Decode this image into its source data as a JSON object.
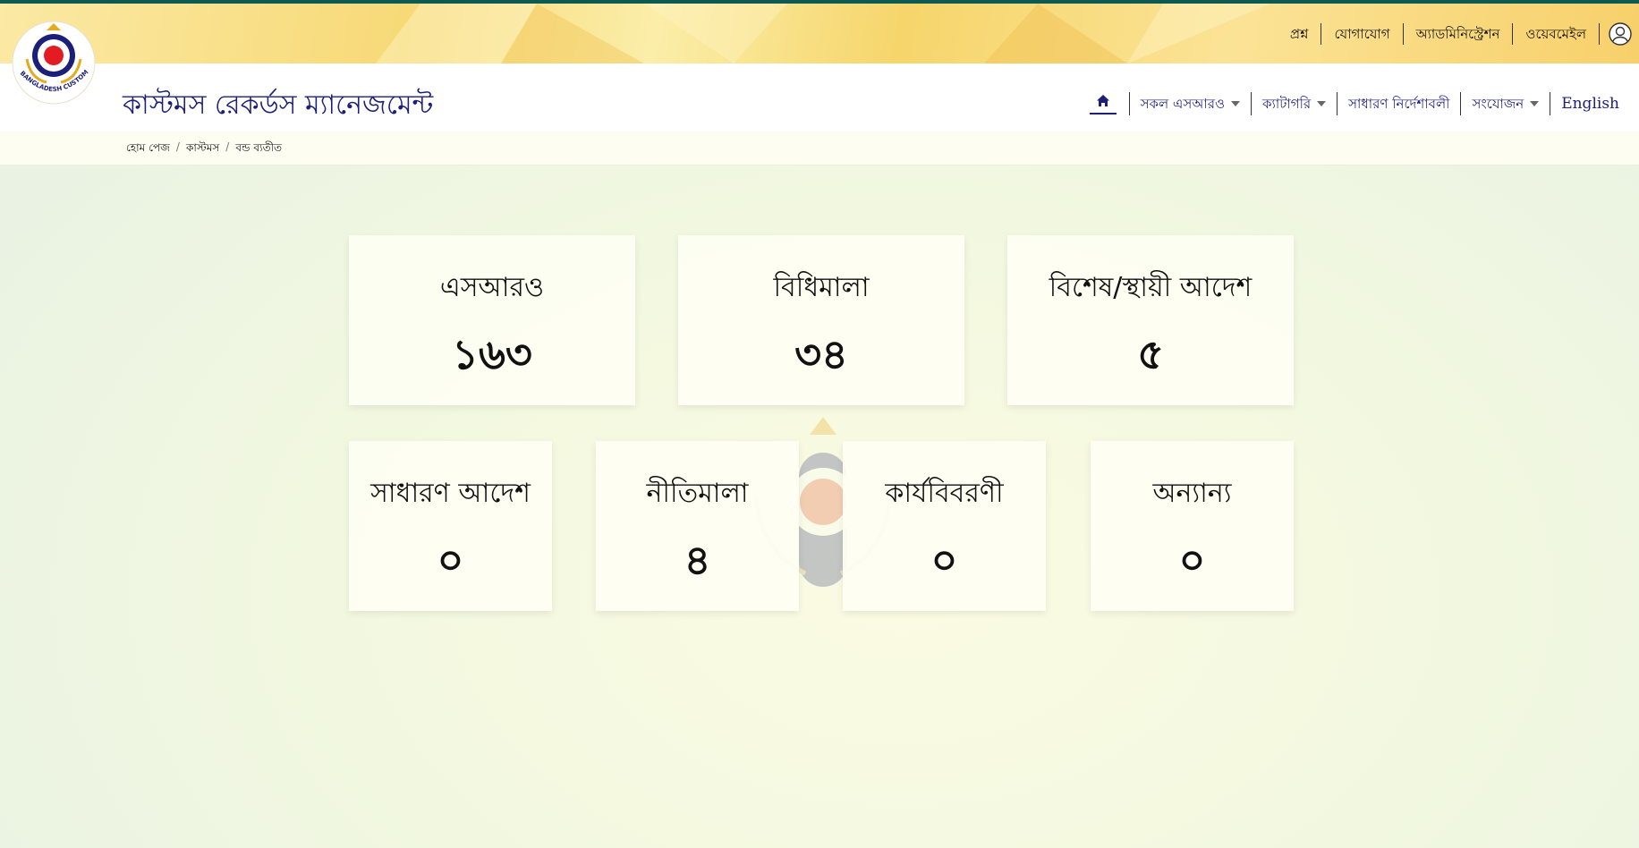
{
  "top_links": [
    "প্রশ্ন",
    "যোগাযোগ",
    "অ্যাডমিনিস্ট্রেশন",
    "ওয়েবমেইল"
  ],
  "site": {
    "title": "কাস্টমস রেকর্ডস ম্যানেজমেন্ট",
    "logo_text": "BANGLADESH CUSTOMS & VAT"
  },
  "menu": {
    "items": [
      {
        "label": "সকল এসআরও",
        "dropdown": true
      },
      {
        "label": "ক্যাটাগরি",
        "dropdown": true
      },
      {
        "label": "সাধারণ নির্দেশাবলী",
        "dropdown": false
      },
      {
        "label": "সংযোজন",
        "dropdown": true
      },
      {
        "label": "English",
        "dropdown": false
      }
    ]
  },
  "breadcrumb": [
    "হোম পেজ",
    "কাস্টমস",
    "বন্ড ব্যতীত"
  ],
  "cards_row1": [
    {
      "title": "এসআরও",
      "count": "১৬৩"
    },
    {
      "title": "বিধিমালা",
      "count": "৩৪"
    },
    {
      "title": "বিশেষ/স্থায়ী আদেশ",
      "count": "৫"
    }
  ],
  "cards_row2": [
    {
      "title": "সাধারণ আদেশ",
      "count": "০"
    },
    {
      "title": "নীতিমালা",
      "count": "৪"
    },
    {
      "title": "কার্যবিবরণী",
      "count": "০"
    },
    {
      "title": "অন্যান্য",
      "count": "০"
    }
  ],
  "colors": {
    "brand_navy": "#1b1f7a",
    "top_accent": "#0d5a52",
    "banner_gold": "#f7d977",
    "logo_red": "#e31b23"
  }
}
